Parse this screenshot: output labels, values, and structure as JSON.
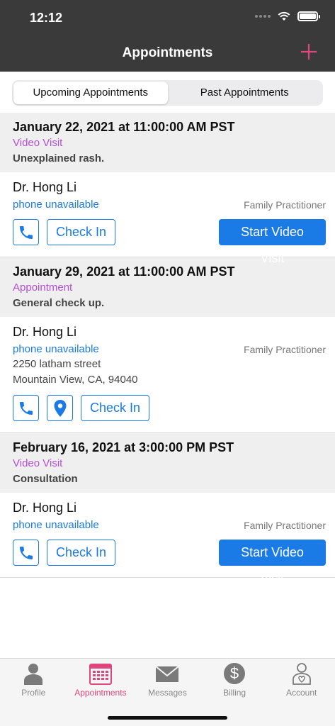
{
  "status": {
    "time": "12:12"
  },
  "nav": {
    "title": "Appointments",
    "add_icon": "plus-icon"
  },
  "segments": {
    "upcoming": "Upcoming Appointments",
    "past": "Past Appointments",
    "selected": "upcoming"
  },
  "appointments": [
    {
      "date": "January 22, 2021 at 11:00:00 AM PST",
      "type": "Video Visit",
      "reason": "Unexplained rash.",
      "doctor": "Dr. Hong Li",
      "phone": "phone unavailable",
      "specialty": "Family Practitioner",
      "check_in": "Check In",
      "video": "Start Video Visit"
    },
    {
      "date": "January 29, 2021 at 11:00:00 AM PST",
      "type": "Appointment",
      "reason": "General check up.",
      "doctor": "Dr. Hong Li",
      "phone": "phone unavailable",
      "specialty": "Family Practitioner",
      "address_line1": "2250 latham street",
      "address_line2": "Mountain View, CA, 94040",
      "check_in": "Check In"
    },
    {
      "date": "February 16, 2021 at 3:00:00 PM PST",
      "type": "Video Visit",
      "reason": "Consultation",
      "doctor": "Dr. Hong Li",
      "phone": "phone unavailable",
      "specialty": "Family Practitioner",
      "check_in": "Check In",
      "video": "Start Video Visit"
    }
  ],
  "tabs": [
    {
      "label": "Profile",
      "icon": "person-icon"
    },
    {
      "label": "Appointments",
      "icon": "calendar-icon",
      "active": true
    },
    {
      "label": "Messages",
      "icon": "envelope-icon"
    },
    {
      "label": "Billing",
      "icon": "dollar-icon"
    },
    {
      "label": "Account",
      "icon": "account-icon"
    }
  ],
  "colors": {
    "accent": "#e0467c",
    "link": "#1a7ae6",
    "visit_type": "#b44fd6",
    "header": "#3a3a3a"
  }
}
